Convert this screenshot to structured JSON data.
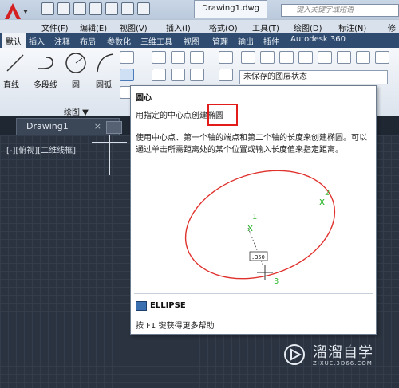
{
  "window": {
    "tab_title": "Drawing1.dwg",
    "search_placeholder": "键入关键字或短语"
  },
  "menu": {
    "items": [
      "文件(F)",
      "编辑(E)",
      "视图(V)",
      "插入(I)",
      "格式(O)",
      "工具(T)",
      "绘图(D)",
      "标注(N)",
      "修"
    ]
  },
  "ribbon_tabs": [
    "默认",
    "插入",
    "注释",
    "布局",
    "参数化",
    "三维工具",
    "视图",
    "管理",
    "输出",
    "插件",
    "Autodesk 360"
  ],
  "ribbon": {
    "tools": [
      "直线",
      "多段线",
      "圆",
      "圆弧"
    ],
    "panel_title": "绘图 ▼",
    "layer_state": "未保存的图层状态"
  },
  "document": {
    "tab_label": "Drawing1",
    "close": "×",
    "viewport_label": "[-][俯视][二维线框]"
  },
  "tooltip": {
    "title": "圆心",
    "subtitle": "用指定的中心点创建椭圆",
    "description": "使用中心点、第一个轴的端点和第二个轴的长度来创建椭圆。可以通过单击所需距离处的某个位置或输入长度值来指定距离。",
    "diagram": {
      "point1": "1",
      "point2": "2",
      "point3": "3",
      "dimension": ".350"
    },
    "command": "ELLIPSE",
    "help": "按 F1 键获得更多帮助"
  },
  "watermark": {
    "name": "溜溜自学",
    "url": "ZIXUE.3D66.COM"
  },
  "colors": {
    "highlight": "#e21b1b",
    "ellipse": "#e0322d",
    "point": "#2fb82f",
    "canvas": "#2b3340"
  }
}
